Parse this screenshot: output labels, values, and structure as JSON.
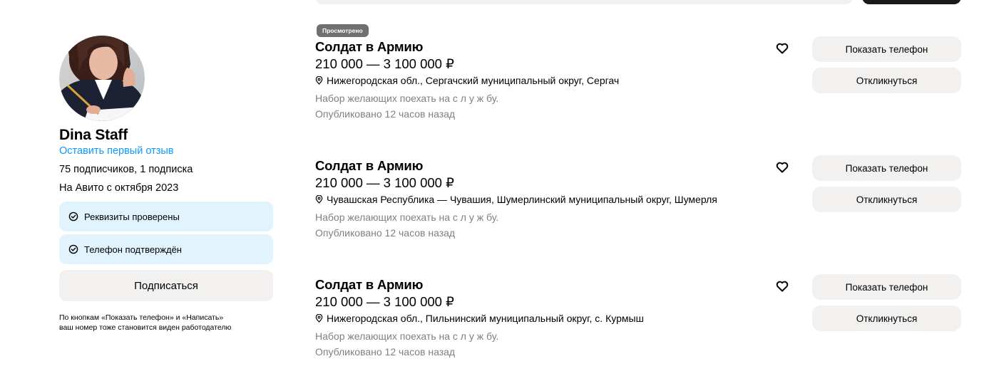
{
  "seller": {
    "name": "Dina Staff",
    "review_link": "Оставить первый отзыв",
    "followers": "75 подписчиков, 1 подписка",
    "since": "На Авито с октября 2023",
    "badges": [
      {
        "label": "Реквизиты проверены",
        "icon": "check-circle-icon"
      },
      {
        "label": "Телефон подтверждён",
        "icon": "check-circle-icon"
      }
    ],
    "subscribe_label": "Подписаться",
    "note_line1": "По кнопкам «Показать телефон» и «Написать»",
    "note_line2": "ваш номер тоже становится виден работодателю",
    "badge_color": "#e1f3fc",
    "link_color": "#0a99ff"
  },
  "listings": [
    {
      "viewed_badge": "Просмотрено",
      "title": "Солдат в Армию",
      "price": "210 000 — 3 100 000 ₽",
      "location": "Нижегородская обл., Сергачский муниципальный округ, Сергач",
      "description": "Набор желающих поехать на с л у ж бу.",
      "published": "Опубликовано 12 часов назад",
      "show_phone_label": "Показать телефон",
      "respond_label": "Откликнуться"
    },
    {
      "title": "Солдат в Армию",
      "price": "210 000 — 3 100 000 ₽",
      "location": "Чувашская Республика — Чувашия, Шумерлинский муниципальный округ, Шумерля",
      "description": "Набор желающих поехать на с л у ж бу.",
      "published": "Опубликовано 12 часов назад",
      "show_phone_label": "Показать телефон",
      "respond_label": "Откликнуться"
    },
    {
      "title": "Солдат в Армию",
      "price": "210 000 — 3 100 000 ₽",
      "location": "Нижегородская обл., Пильнинский муниципальный округ, с. Курмыш",
      "description": "Набор желающих поехать на с л у ж бу.",
      "published": "Опубликовано 12 часов назад",
      "show_phone_label": "Показать телефон",
      "respond_label": "Откликнуться"
    }
  ]
}
